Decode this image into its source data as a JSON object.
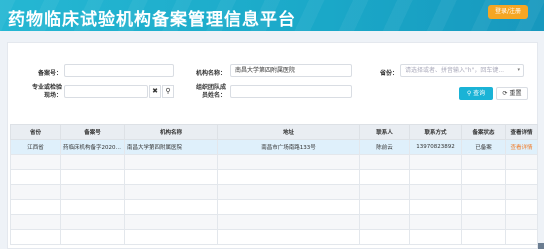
{
  "header": {
    "title": "药物临床试验机构备案管理信息平台",
    "login_label": "登录/注册"
  },
  "filters": {
    "record_no": {
      "label": "备案号：",
      "value": ""
    },
    "org_name": {
      "label": "机构名称：",
      "value": "南昌大学第四附属医院"
    },
    "province": {
      "label": "省份：",
      "placeholder": "请选择或者、拼音输入\"h\"，回车键..."
    },
    "specialty": {
      "label_line1": "专业或检验",
      "label_line2": "现场：",
      "value": ""
    },
    "leader": {
      "label_line1": "组织团队成",
      "label_line2": "员姓名：",
      "value": ""
    },
    "clear_symbol": "✖",
    "search_symbol": "⚲",
    "search_button": "查询",
    "reset_button": "重置"
  },
  "table": {
    "columns": [
      "省份",
      "备案号",
      "机构名称",
      "地址",
      "联系人",
      "联系方式",
      "备案状态",
      "查看详情"
    ],
    "rows": [
      [
        "江西省",
        "药临床机构备字202000...",
        "南昌大学第四附属医院",
        "南昌市广场南路133号",
        "陈前云",
        "13970823892",
        "已备案",
        "查看详情"
      ]
    ],
    "empty_rows": 6
  }
}
